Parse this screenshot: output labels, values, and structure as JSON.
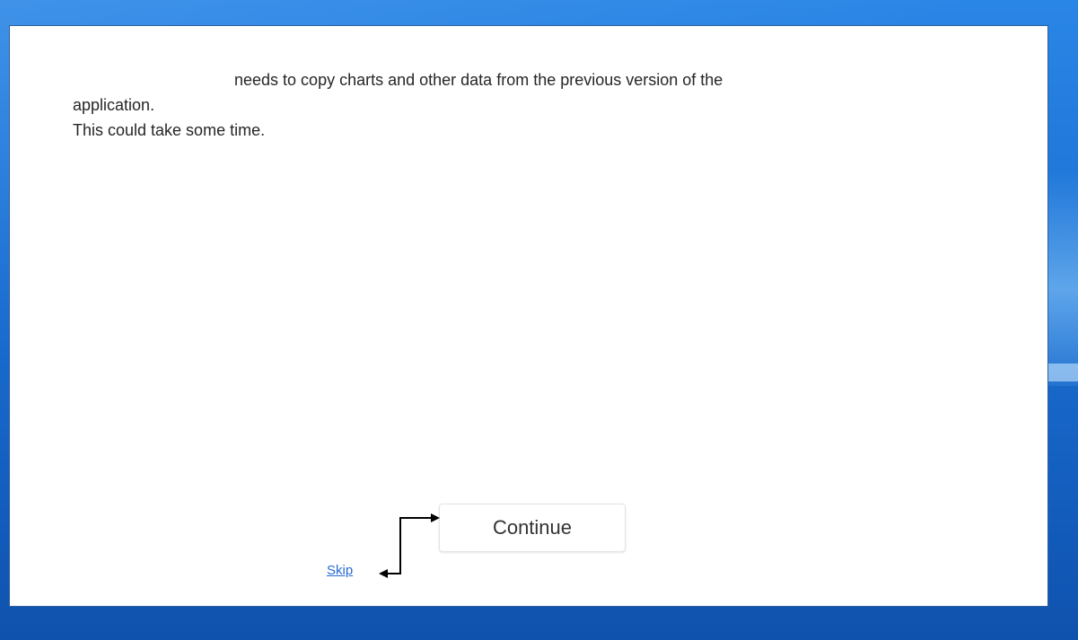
{
  "dialog": {
    "message_line1": "needs to copy charts and other data from the previous version of the",
    "message_line2": "application.",
    "message_line3": "This could take some time."
  },
  "actions": {
    "continue_label": "Continue",
    "skip_label": "Skip"
  },
  "annotation": {
    "icon": "bidirectional-elbow-arrow-icon",
    "color": "#000000"
  },
  "colors": {
    "desktop_background": "#1a6fd2",
    "link": "#2a6ad1"
  }
}
